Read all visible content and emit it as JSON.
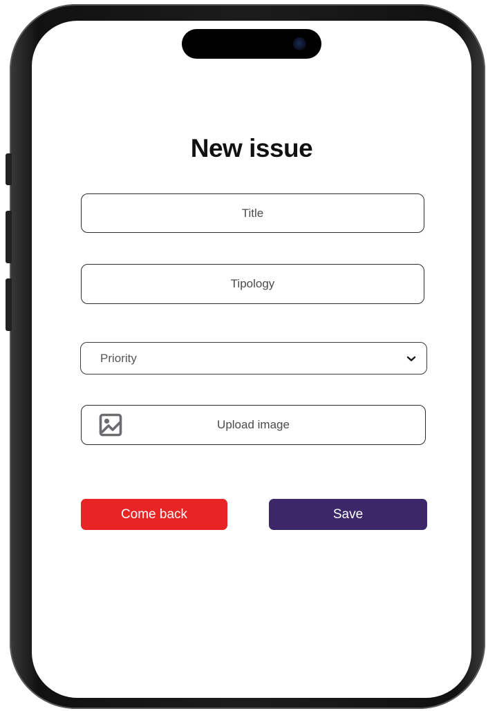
{
  "screen": {
    "title": "New issue"
  },
  "form": {
    "title_placeholder": "Title",
    "typology_placeholder": "Tipology",
    "priority": {
      "selected": "Priority",
      "chevron_icon": "chevron-down-icon"
    },
    "upload": {
      "label": "Upload image",
      "icon": "image-icon"
    }
  },
  "actions": {
    "back_label": "Come back",
    "save_label": "Save"
  },
  "colors": {
    "back_button": "#e82424",
    "save_button": "#3b2769",
    "border": "#2a2a2a",
    "title_text": "#111111"
  }
}
